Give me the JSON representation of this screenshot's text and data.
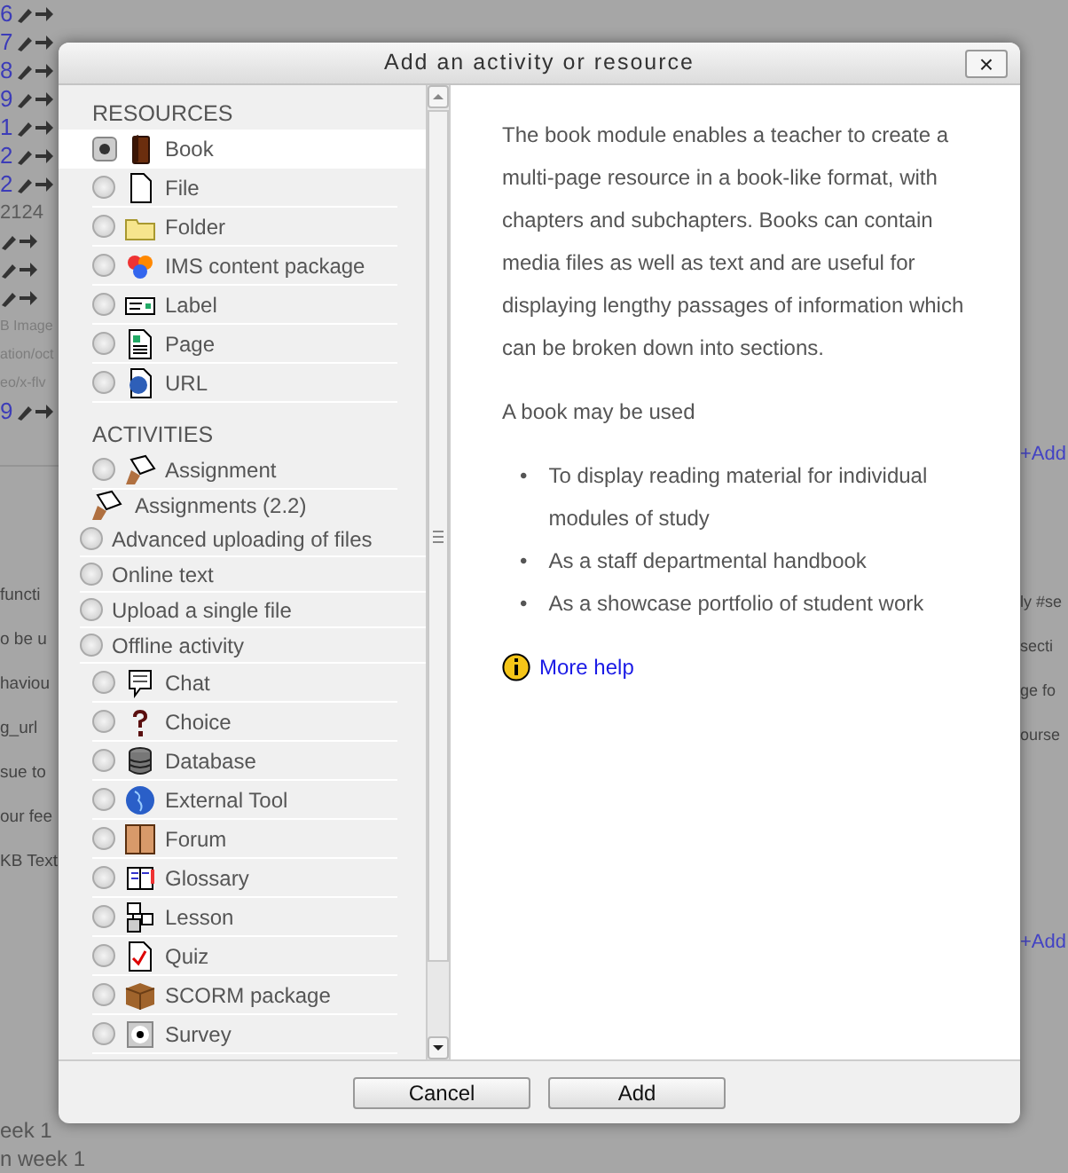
{
  "background": {
    "left_rows": [
      {
        "kind": "link",
        "text": "6"
      },
      {
        "kind": "link",
        "text": "7"
      },
      {
        "kind": "link",
        "text": "8"
      },
      {
        "kind": "link",
        "text": "9"
      },
      {
        "kind": "link",
        "text": "1"
      },
      {
        "kind": "link",
        "text": "2"
      },
      {
        "kind": "link",
        "text": "2"
      },
      {
        "kind": "gray",
        "text": "2124"
      },
      {
        "kind": "icons"
      },
      {
        "kind": "icons"
      },
      {
        "kind": "icons"
      },
      {
        "kind": "small",
        "text": "B Image"
      },
      {
        "kind": "small",
        "text": "ation/oct"
      },
      {
        "kind": "small",
        "text": "eo/x-flv"
      },
      {
        "kind": "link",
        "text": "9"
      }
    ],
    "left_lines": [
      "functi",
      "o be u",
      "haviou",
      "g_url",
      "sue to",
      "our fee",
      "KB Text"
    ],
    "right_lines": [
      {
        "kind": "add",
        "text": "+Add"
      },
      {
        "kind": "text",
        "text": "ly #se"
      },
      {
        "kind": "text",
        "text": "secti"
      },
      {
        "kind": "text",
        "text": "ge fo"
      },
      {
        "kind": "text",
        "text": "ourse"
      },
      {
        "kind": "add",
        "text": "+Add"
      }
    ],
    "bottom_rows": [
      "eek 1",
      "n week 1"
    ]
  },
  "dialog": {
    "title": "Add an activity or resource",
    "close": "×",
    "items": [
      {
        "kind": "header",
        "label": "RESOURCES"
      },
      {
        "kind": "module",
        "label": "Book",
        "selected": true
      },
      {
        "kind": "module",
        "label": "File",
        "selected": false
      },
      {
        "kind": "module",
        "label": "Folder",
        "selected": false
      },
      {
        "kind": "module",
        "label": "IMS content package",
        "selected": false
      },
      {
        "kind": "module",
        "label": "Label",
        "selected": false
      },
      {
        "kind": "module",
        "label": "Page",
        "selected": false
      },
      {
        "kind": "module",
        "label": "URL",
        "selected": false
      },
      {
        "kind": "header",
        "label": "ACTIVITIES"
      },
      {
        "kind": "module",
        "label": "Assignment",
        "selected": false
      },
      {
        "kind": "group",
        "label": "Assignments (2.2)"
      },
      {
        "kind": "subtype",
        "label": "Advanced uploading of files",
        "selected": false
      },
      {
        "kind": "subtype",
        "label": "Online text",
        "selected": false
      },
      {
        "kind": "subtype",
        "label": "Upload a single file",
        "selected": false
      },
      {
        "kind": "subtype",
        "label": "Offline activity",
        "selected": false
      },
      {
        "kind": "module",
        "label": "Chat",
        "selected": false
      },
      {
        "kind": "module",
        "label": "Choice",
        "selected": false
      },
      {
        "kind": "module",
        "label": "Database",
        "selected": false
      },
      {
        "kind": "module",
        "label": "External Tool",
        "selected": false
      },
      {
        "kind": "module",
        "label": "Forum",
        "selected": false
      },
      {
        "kind": "module",
        "label": "Glossary",
        "selected": false
      },
      {
        "kind": "module",
        "label": "Lesson",
        "selected": false
      },
      {
        "kind": "module",
        "label": "Quiz",
        "selected": false
      },
      {
        "kind": "module",
        "label": "SCORM package",
        "selected": false
      },
      {
        "kind": "module",
        "label": "Survey",
        "selected": false
      }
    ],
    "description": {
      "paragraphs": [
        "The book module enables a teacher to create a multi-page resource in a book-like format, with chapters and subchapters. Books can contain media files as well as text and are useful for displaying lengthy passages of information which can be broken down into sections.",
        "A book may be used"
      ],
      "bullets": [
        {
          "marker": "•",
          "text": "To display reading material for individual modules of study"
        },
        {
          "marker": "•",
          "text": "As a staff departmental handbook"
        },
        {
          "marker": "•",
          "text": "As a showcase portfolio of student work"
        }
      ],
      "help_link": "More help"
    },
    "buttons": [
      "Cancel",
      "Add"
    ]
  }
}
